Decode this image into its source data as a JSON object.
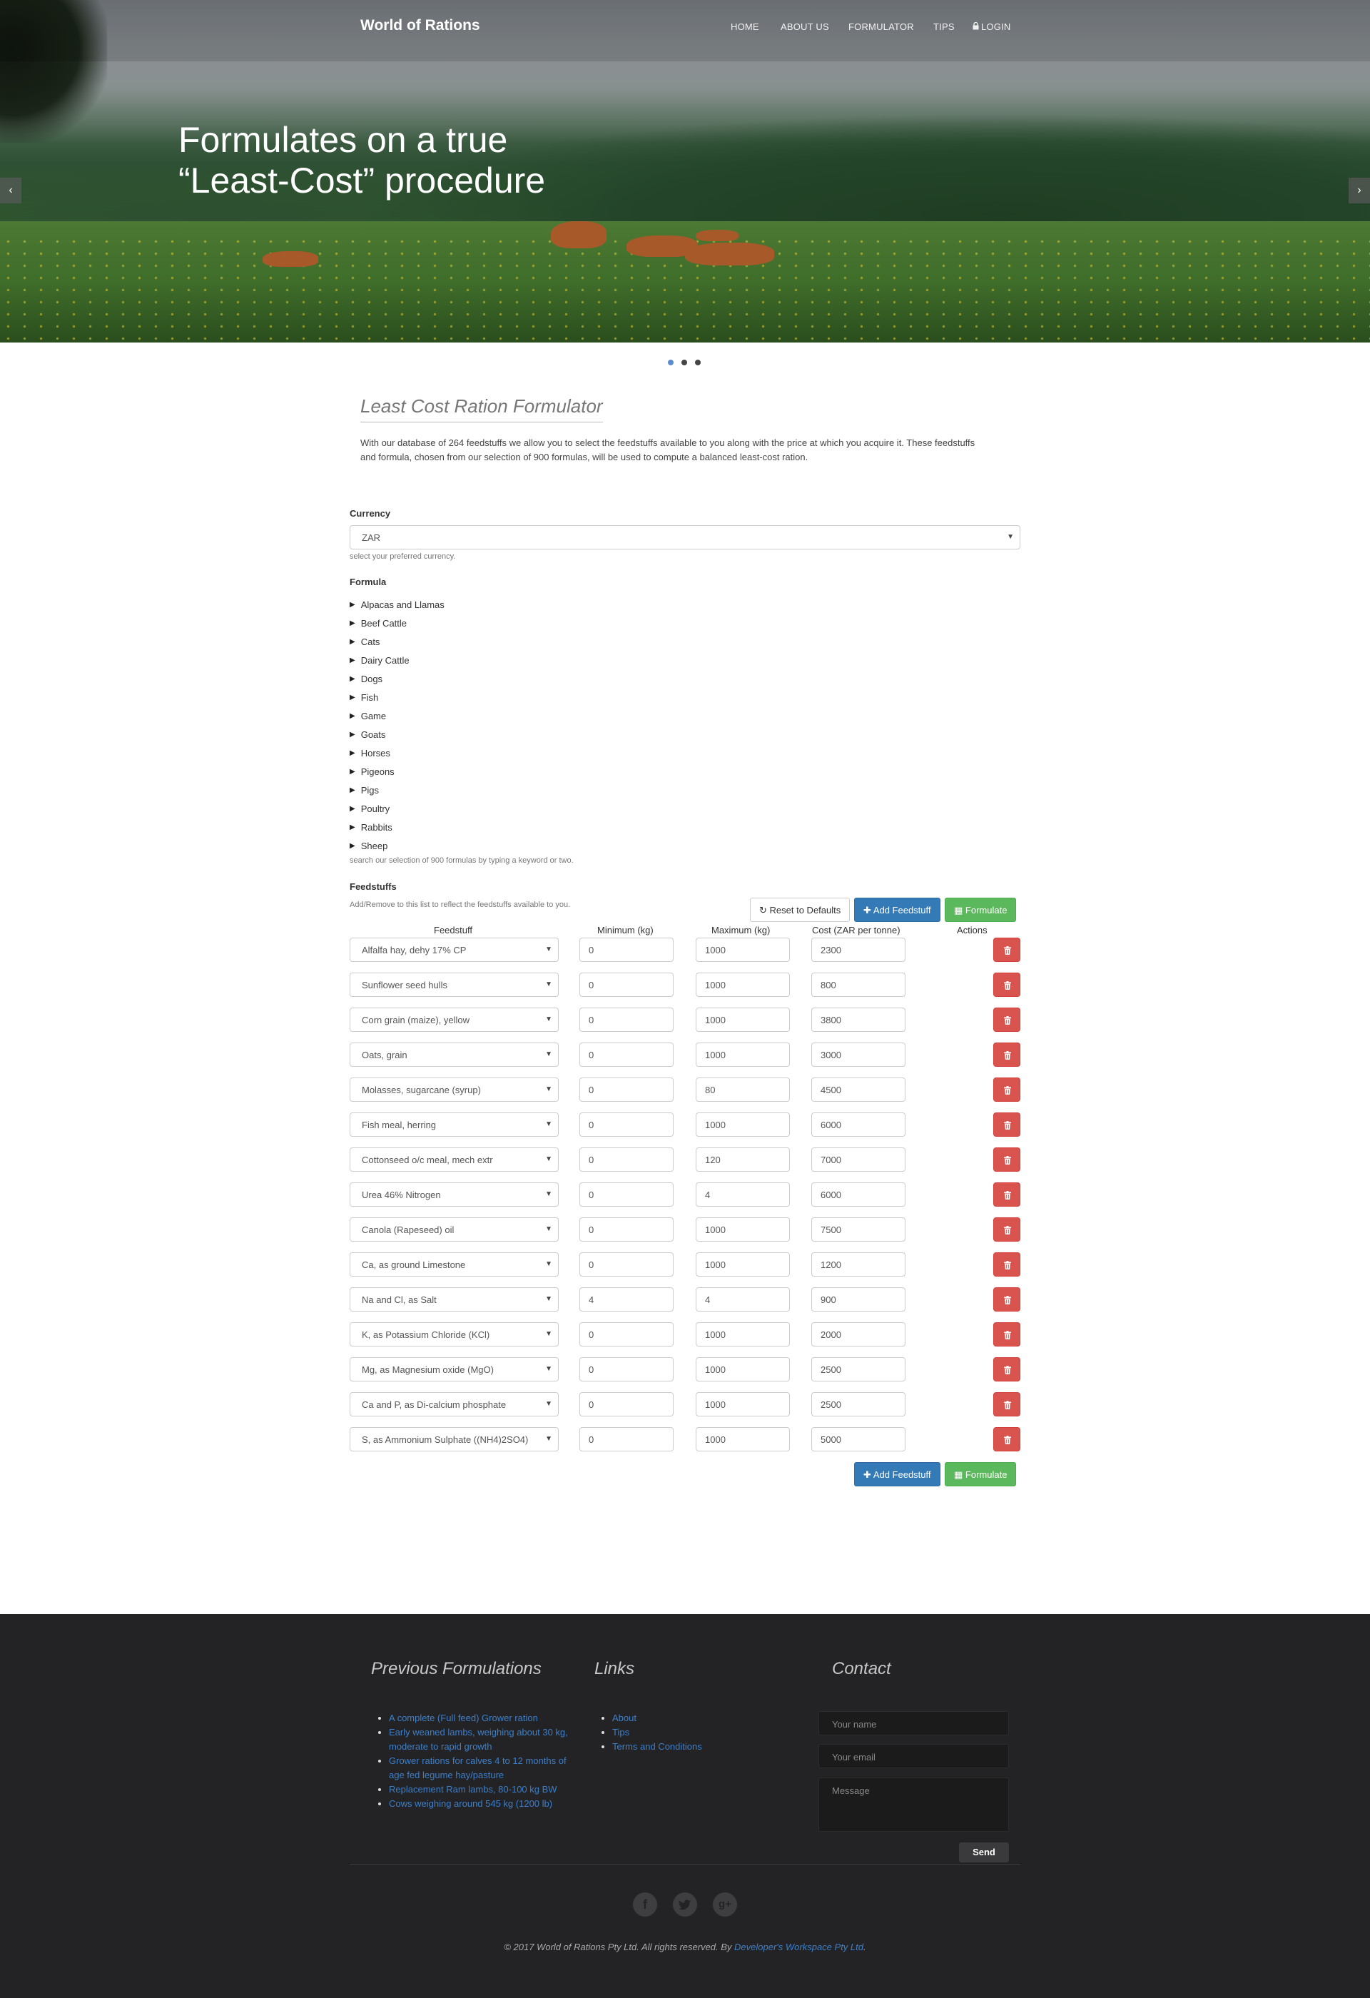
{
  "brand": "World of Rations",
  "nav": [
    "HOME",
    "ABOUT US",
    "FORMULATOR",
    "TIPS",
    "LOGIN"
  ],
  "hero": {
    "line1": "Formulates on a true",
    "line2": "“Least-Cost” procedure",
    "slides": 3,
    "active_slide": 1
  },
  "formulator": {
    "title": "Least Cost Ration Formulator",
    "intro": "With our database of 264 feedstuffs we allow you to select the feedstuffs available to you along with the price at which you acquire it. These feedstuffs and formula, chosen from our selection of 900 formulas, will be used to compute a balanced least-cost ration."
  },
  "currency": {
    "label": "Currency",
    "value": "ZAR",
    "help": "select your preferred currency."
  },
  "formula": {
    "label": "Formula",
    "categories": [
      "Alpacas and Llamas",
      "Beef Cattle",
      "Cats",
      "Dairy Cattle",
      "Dogs",
      "Fish",
      "Game",
      "Goats",
      "Horses",
      "Pigeons",
      "Pigs",
      "Poultry",
      "Rabbits",
      "Sheep"
    ],
    "help": "search our selection of 900 formulas by typing a keyword or two."
  },
  "feedstuffs": {
    "label": "Feedstuffs",
    "help": "Add/Remove to this list to reflect the feedstuffs available to you.",
    "reset_label": "Reset to Defaults",
    "add_label": "Add Feedstuff",
    "formulate_label": "Formulate",
    "headers": [
      "Feedstuff",
      "Minimum (kg)",
      "Maximum (kg)",
      "Cost (ZAR per tonne)",
      "Actions"
    ],
    "rows": [
      {
        "name": "Alfalfa hay, dehy 17% CP",
        "min": "0",
        "max": "1000",
        "cost": "2300"
      },
      {
        "name": "Sunflower seed hulls",
        "min": "0",
        "max": "1000",
        "cost": "800"
      },
      {
        "name": "Corn grain (maize), yellow",
        "min": "0",
        "max": "1000",
        "cost": "3800"
      },
      {
        "name": "Oats, grain",
        "min": "0",
        "max": "1000",
        "cost": "3000"
      },
      {
        "name": "Molasses, sugarcane (syrup)",
        "min": "0",
        "max": "80",
        "cost": "4500"
      },
      {
        "name": "Fish meal, herring",
        "min": "0",
        "max": "1000",
        "cost": "6000"
      },
      {
        "name": "Cottonseed o/c meal, mech extr",
        "min": "0",
        "max": "120",
        "cost": "7000"
      },
      {
        "name": "Urea 46% Nitrogen",
        "min": "0",
        "max": "4",
        "cost": "6000"
      },
      {
        "name": "Canola (Rapeseed) oil",
        "min": "0",
        "max": "1000",
        "cost": "7500"
      },
      {
        "name": "Ca, as ground Limestone",
        "min": "0",
        "max": "1000",
        "cost": "1200"
      },
      {
        "name": "Na and Cl, as Salt",
        "min": "4",
        "max": "4",
        "cost": "900"
      },
      {
        "name": "K, as Potassium Chloride (KCl)",
        "min": "0",
        "max": "1000",
        "cost": "2000"
      },
      {
        "name": "Mg, as Magnesium oxide (MgO)",
        "min": "0",
        "max": "1000",
        "cost": "2500"
      },
      {
        "name": "Ca and P, as Di-calcium phosphate",
        "min": "0",
        "max": "1000",
        "cost": "2500"
      },
      {
        "name": "S, as Ammonium Sulphate ((NH4)2SO4)",
        "min": "0",
        "max": "1000",
        "cost": "5000"
      }
    ]
  },
  "footer": {
    "previous_title": "Previous Formulations",
    "previous": [
      "A complete (Full feed) Grower ration",
      "Early weaned lambs, weighing about 30 kg, moderate to rapid growth",
      "Grower rations for calves 4 to 12 months of age fed legume hay/pasture",
      "Replacement Ram lambs, 80-100 kg BW",
      "Cows weighing around 545 kg (1200 lb)"
    ],
    "links_title": "Links",
    "links": [
      "About",
      "Tips",
      "Terms and Conditions"
    ],
    "contact_title": "Contact",
    "name_placeholder": "Your name",
    "email_placeholder": "Your email",
    "message_placeholder": "Message",
    "send_label": "Send",
    "social": [
      "facebook-icon",
      "twitter-icon",
      "google-plus-icon"
    ],
    "copyright": "© 2017 World of Rations Pty Ltd. All rights reserved. By ",
    "developer": "Developer's Workspace Pty Ltd",
    "copyright_end": "."
  }
}
